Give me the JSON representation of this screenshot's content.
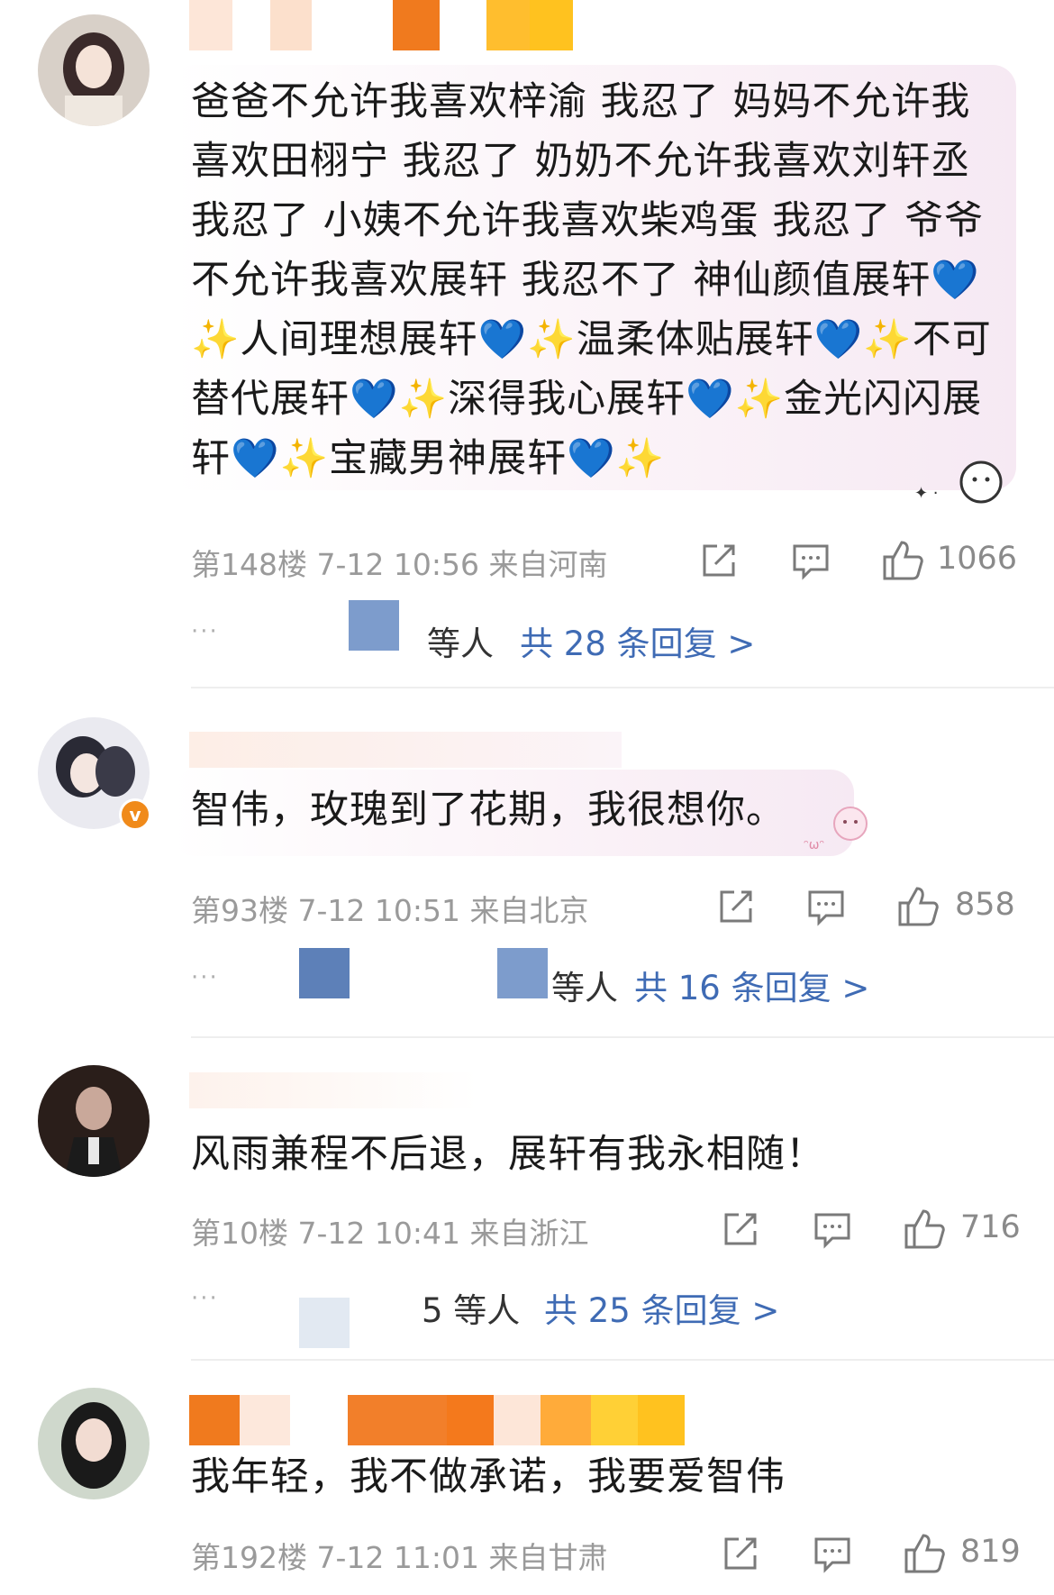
{
  "comments": [
    {
      "text": "爸爸不允许我喜欢梓渝 我忍了 妈妈不允许我喜欢田栩宁 我忍了 奶奶不允许我喜欢刘轩丞我忍了 小姨不允许我喜欢柴鸡蛋 我忍了 爷爷不允许我喜欢展轩 我忍不了 神仙颜值展轩💙✨人间理想展轩💙✨温柔体贴展轩💙✨不可替代展轩💙✨深得我心展轩💙✨金光闪闪展轩💙✨宝藏男神展轩💙✨",
      "floor": "第148楼",
      "time": "7-12 10:56",
      "location": "来自河南",
      "likes": "1066",
      "others": "等人",
      "replies": "共 28 条回复 >"
    },
    {
      "text": "智伟，玫瑰到了花期，我很想你。",
      "floor": "第93楼",
      "time": "7-12 10:51",
      "location": "来自北京",
      "likes": "858",
      "others": "等人",
      "replies": "共 16 条回复 >"
    },
    {
      "text": "风雨兼程不后退，展轩有我永相随！",
      "floor": "第10楼",
      "time": "7-12 10:41",
      "location": "来自浙江",
      "likes": "716",
      "others": "5 等人",
      "replies": "共 25 条回复 >"
    },
    {
      "text": "我年轻，我不做承诺，我要爱智伟",
      "floor": "第192楼",
      "time": "7-12 11:01",
      "location": "来自甘肃",
      "likes": "819"
    }
  ],
  "icons": {
    "share": "share-icon",
    "comment": "comment-icon",
    "like": "thumbs-up-icon",
    "more": "more-dots-icon"
  },
  "colors": {
    "reply_link": "#3f6bb4",
    "meta_text": "#9a9a9a",
    "bubble_tint": "#f6e9f3"
  }
}
